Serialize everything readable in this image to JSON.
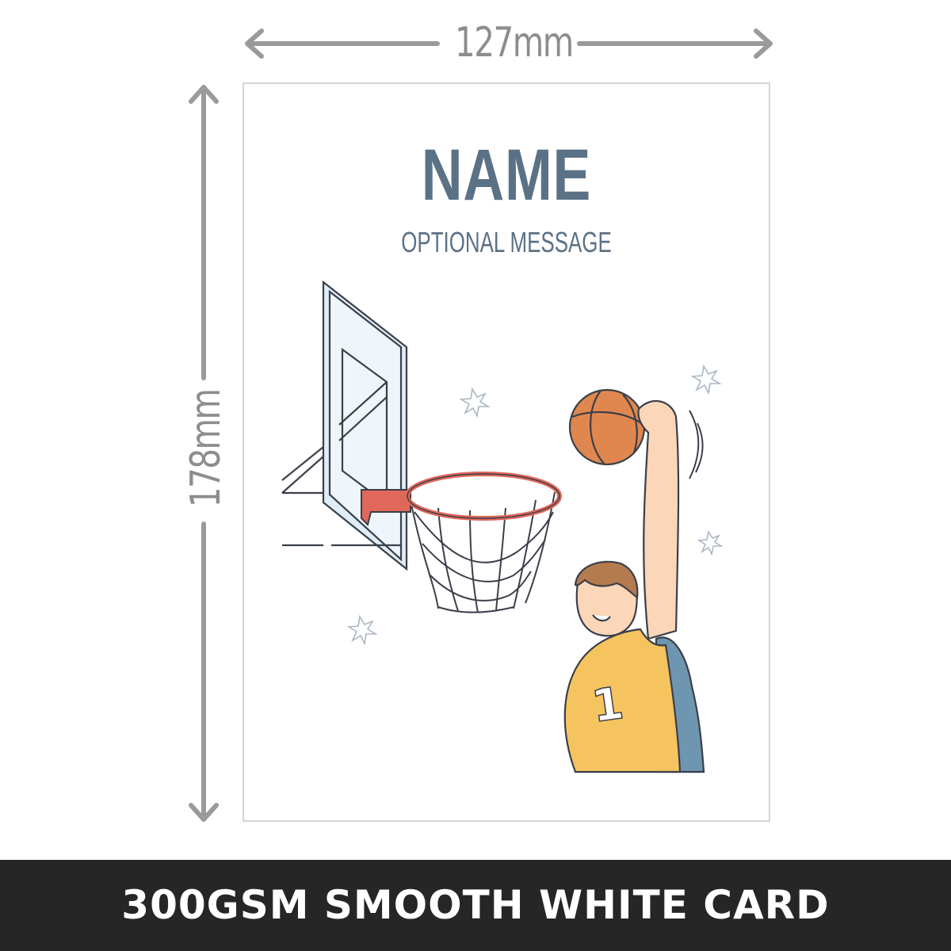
{
  "dimensions": {
    "width_label": "127mm",
    "height_label": "178mm"
  },
  "card": {
    "name": "NAME",
    "message": "OPTIONAL MESSAGE",
    "illustration": "basketball-player-dunking",
    "jersey_number": "1"
  },
  "footer": {
    "text": "300GSM SMOOTH WHITE CARD"
  },
  "colors": {
    "title": "#5b7186",
    "dimension": "#8d8d8d",
    "footer_bg": "#262626",
    "ball": "#e0874f",
    "rim": "#e0685a",
    "jersey": "#f6c45e",
    "jersey_side": "#6f96b0"
  }
}
